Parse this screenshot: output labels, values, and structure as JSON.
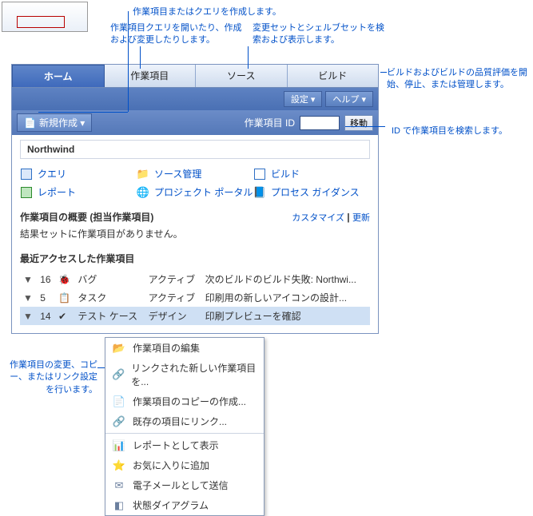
{
  "annotations": {
    "a1": "作業項目またはクエリを作成します。",
    "a2": "作業項目クエリを開いたり、作成および変更したりします。",
    "a3": "変更セットとシェルブセットを検索および表示します。",
    "a4": "ビルドおよびビルドの品質評価を開始、停止、または管理します。",
    "a5": "ID で作業項目を検索します。",
    "a6": "作業項目の変更、コピー、またはリンク設定を行います。"
  },
  "tabs": {
    "home": "ホーム",
    "workitems": "作業項目",
    "source": "ソース",
    "build": "ビルド"
  },
  "toolbar": {
    "settings": "設定 ▾",
    "help": "ヘルプ ▾",
    "new": "新規作成 ▾",
    "id_label": "作業項目 ID",
    "go": "移動"
  },
  "project": "Northwind",
  "links": {
    "query": "クエリ",
    "source": "ソース管理",
    "build": "ビルド",
    "report": "レポート",
    "portal": "プロジェクト ポータル",
    "guidance": "プロセス ガイダンス"
  },
  "overview": {
    "title": "作業項目の概要 (担当作業項目)",
    "customize": "カスタマイズ",
    "sep": " | ",
    "refresh": "更新",
    "empty": "結果セットに作業項目がありません。"
  },
  "recent": {
    "title": "最近アクセスした作業項目",
    "rows": [
      {
        "id": "16",
        "type": "バグ",
        "state": "アクティブ",
        "title": "次のビルドのビルド失敗: Northwi..."
      },
      {
        "id": "5",
        "type": "タスク",
        "state": "アクティブ",
        "title": "印刷用の新しいアイコンの設計..."
      },
      {
        "id": "14",
        "type": "テスト ケース",
        "state": "デザイン",
        "title": "印刷プレビューを確認"
      }
    ]
  },
  "context_menu": {
    "edit": "作業項目の編集",
    "linked_new": "リンクされた新しい作業項目を...",
    "copy": "作業項目のコピーの作成...",
    "link_existing": "既存の項目にリンク...",
    "as_report": "レポートとして表示",
    "favorite": "お気に入りに追加",
    "email": "電子メールとして送信",
    "state_diagram": "状態ダイアグラム"
  }
}
